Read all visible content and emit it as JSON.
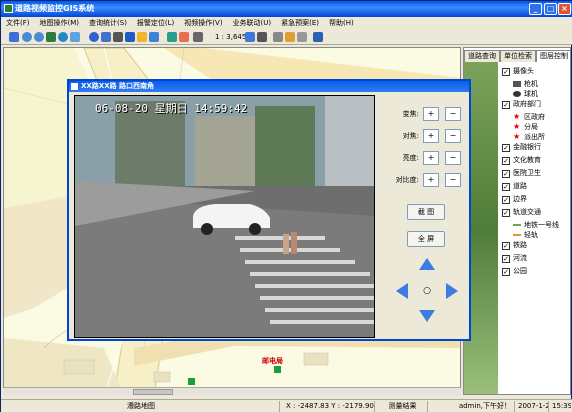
{
  "title": "道路视频监控GIS系统",
  "menu": [
    "文件(F)",
    "地图操作(M)",
    "查询统计(S)",
    "报警定位(L)",
    "视频操作(V)",
    "业务联动(U)",
    "紧急预案(E)",
    "帮助(H)"
  ],
  "toolbar": {
    "scale": "1 : 3,645"
  },
  "window_buttons": {
    "minimize": "_",
    "maximize": "□",
    "close": "×"
  },
  "dialog": {
    "title": "XX路XX路 路口西南角",
    "osd": "06-08-20 星期日 14:59:42",
    "controls": [
      {
        "label": "变焦:",
        "plus": "+",
        "minus": "−"
      },
      {
        "label": "对焦:",
        "plus": "+",
        "minus": "−"
      },
      {
        "label": "亮度:",
        "plus": "+",
        "minus": "−"
      },
      {
        "label": "对比度:",
        "plus": "+",
        "minus": "−"
      }
    ],
    "capture_btn": "截 图",
    "fullscreen_btn": "全 屏",
    "ptz_center": "○"
  },
  "map": {
    "poi_label": "邮电局"
  },
  "right_panel": {
    "tabs": [
      "道路查询",
      "单位检索",
      "图层控制"
    ],
    "layers": [
      {
        "label": "摄像头",
        "checked": true,
        "subs": [
          {
            "label": "枪机",
            "icon": "gun-camera-icon"
          },
          {
            "label": "球机",
            "icon": "dome-camera-icon"
          }
        ]
      },
      {
        "label": "政府部门",
        "checked": true,
        "subs": [
          {
            "label": "区政府",
            "icon": "star-icon"
          },
          {
            "label": "分局",
            "icon": "star-icon"
          },
          {
            "label": "派出所",
            "icon": "star-icon"
          }
        ]
      },
      {
        "label": "金融银行",
        "checked": true,
        "subs": []
      },
      {
        "label": "文化教育",
        "checked": true,
        "subs": []
      },
      {
        "label": "医院卫生",
        "checked": true,
        "subs": []
      },
      {
        "label": "道路",
        "checked": true,
        "subs": []
      },
      {
        "label": "边界",
        "checked": true,
        "subs": []
      },
      {
        "label": "轨道交通",
        "checked": true,
        "subs": [
          {
            "label": "地铁一号线",
            "icon": "line-icon"
          },
          {
            "label": "轻轨",
            "icon": "line-icon"
          }
        ]
      },
      {
        "label": "铁路",
        "checked": true,
        "subs": []
      },
      {
        "label": "河流",
        "checked": true,
        "subs": []
      },
      {
        "label": "公园",
        "checked": true,
        "subs": []
      }
    ]
  },
  "status": {
    "map_name": "漕路地图",
    "coords": "X : -2487.83  Y : -2179.90米",
    "result": "测量结果",
    "user": "admin,下午好！",
    "date": "2007-1-29",
    "time": "15:39"
  }
}
